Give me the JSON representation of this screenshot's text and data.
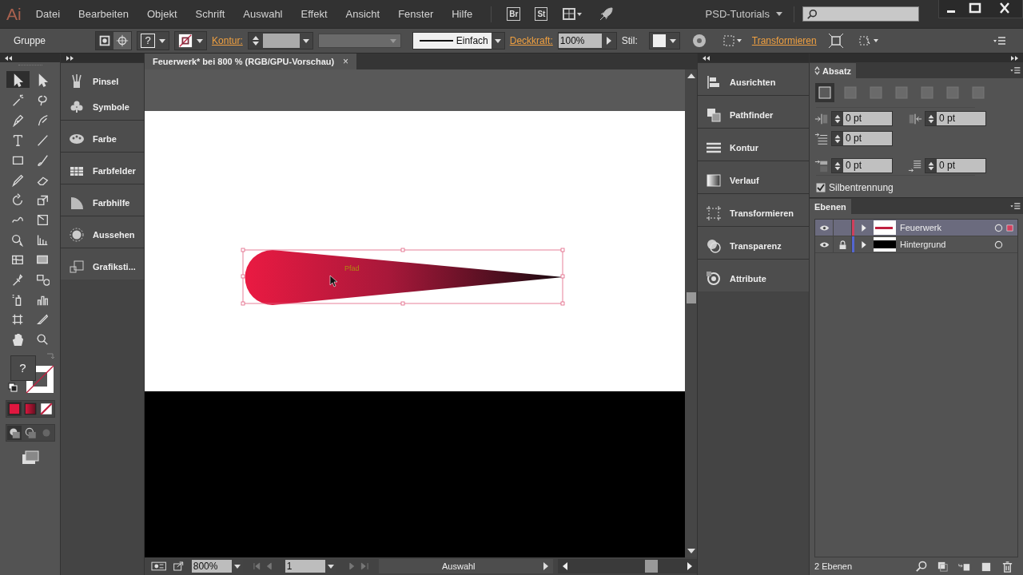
{
  "app": {
    "logo": "Ai"
  },
  "menu": [
    "Datei",
    "Bearbeiten",
    "Objekt",
    "Schrift",
    "Auswahl",
    "Effekt",
    "Ansicht",
    "Fenster",
    "Hilfe"
  ],
  "bridge_buttons": [
    "Br",
    "St"
  ],
  "workspace": "PSD-Tutorials",
  "control_bar": {
    "selection_type": "Gruppe",
    "fill_hint": "?",
    "stroke_label": "Kontur:",
    "stroke_profile": "Einfach",
    "opacity_label": "Deckkraft:",
    "opacity": "100%",
    "style_label": "Stil:",
    "transform_link": "Transformieren"
  },
  "toolbar": {
    "fill_stroke_hint": "?"
  },
  "left_dock": [
    {
      "label": "Pinsel"
    },
    {
      "label": "Symbole"
    },
    {
      "label": "Farbe"
    },
    {
      "label": "Farbfelder"
    },
    {
      "label": "Farbhilfe"
    },
    {
      "label": "Aussehen"
    },
    {
      "label": "Grafiksti..."
    }
  ],
  "document": {
    "tab_title": "Feuerwerk* bei 800 % (RGB/GPU-Vorschau)",
    "close": "×",
    "hover_label": "Pfad",
    "zoom": "800%",
    "artboard": "1",
    "status": "Auswahl"
  },
  "right_dock": [
    {
      "label": "Ausrichten"
    },
    {
      "label": "Pathfinder"
    },
    {
      "label": "Kontur"
    },
    {
      "label": "Verlauf"
    },
    {
      "label": "Transformieren"
    },
    {
      "label": "Transparenz"
    },
    {
      "label": "Attribute"
    }
  ],
  "paragraph_panel": {
    "title": "Absatz",
    "alignments": [
      {
        "selected": true
      },
      {
        "selected": false
      },
      {
        "selected": false
      },
      {
        "selected": false
      },
      {
        "selected": false
      },
      {
        "selected": false
      },
      {
        "selected": false
      }
    ],
    "fields": [
      "0 pt",
      "0 pt",
      "0 pt",
      "0 pt",
      "0 pt"
    ],
    "hyphenation": {
      "label": "Silbentrennung",
      "checked": true
    }
  },
  "layers_panel": {
    "title": "Ebenen",
    "layers": [
      {
        "name": "Feuerwerk",
        "selected": true,
        "locked": false,
        "color": "#d0405e"
      },
      {
        "name": "Hintergrund",
        "selected": false,
        "locked": true,
        "color": "#5466d0"
      }
    ],
    "count": "2 Ebenen"
  }
}
